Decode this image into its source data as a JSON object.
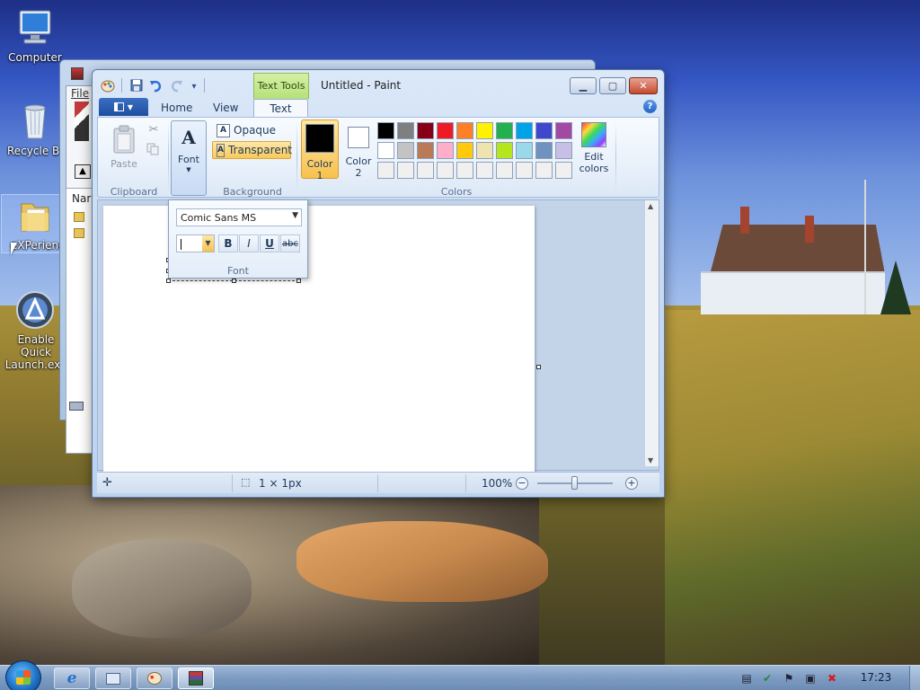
{
  "desktop": {
    "icons": [
      {
        "label": "Computer",
        "icon": "computer-icon"
      },
      {
        "label": "Recycle Bin",
        "icon": "recycle-bin-icon"
      },
      {
        "label": "eXPerience",
        "icon": "folder-icon"
      },
      {
        "label": "Enable Quick Launch.exe",
        "icon": "quick-launch-app-icon"
      }
    ]
  },
  "explorer": {
    "menu_file": "File",
    "column_header": "Nar"
  },
  "paint": {
    "title": "Untitled - Paint",
    "contextual_tab": "Text Tools",
    "tabs": [
      "Home",
      "View",
      "Text"
    ],
    "active_tab": "Text",
    "help": "?",
    "clipboard": {
      "paste": "Paste",
      "label": "Clipboard"
    },
    "font_button": "Font",
    "background": {
      "opaque": "Opaque",
      "transparent": "Transparent",
      "label": "Background",
      "selected": "Transparent"
    },
    "colors": {
      "color1": "Color 1",
      "color2": "Color 2",
      "edit": "Edit colors",
      "label": "Colors",
      "color1_value": "#000000",
      "color2_value": "#ffffff",
      "palette_row1": [
        "#000000",
        "#7f7f7f",
        "#880015",
        "#ed1c24",
        "#ff7f27",
        "#fff200",
        "#22b14c",
        "#00a2e8",
        "#3f48cc",
        "#a349a4"
      ],
      "palette_row2": [
        "#ffffff",
        "#c3c3c3",
        "#b97a57",
        "#ffaec9",
        "#ffc90e",
        "#efe4b0",
        "#b5e61d",
        "#99d9ea",
        "#7092be",
        "#c8bfe7"
      ],
      "palette_row3": [
        "#f0f0f0",
        "#f0f0f0",
        "#f0f0f0",
        "#f0f0f0",
        "#f0f0f0",
        "#f0f0f0",
        "#f0f0f0",
        "#f0f0f0",
        "#f0f0f0",
        "#f0f0f0"
      ]
    },
    "font_popup": {
      "family": "Comic Sans MS",
      "size": "",
      "bold": "B",
      "italic": "I",
      "underline": "U",
      "strikethrough": "abc",
      "label": "Font"
    },
    "status": {
      "size": "1 × 1px",
      "zoom": "100%",
      "zoom_fraction": 0.5
    }
  },
  "taskbar": {
    "clock": "17:23",
    "buttons": [
      "internet-explorer-icon",
      "system-monitor-icon",
      "paint-icon",
      "winrar-icon"
    ],
    "active_button": "winrar-icon"
  }
}
